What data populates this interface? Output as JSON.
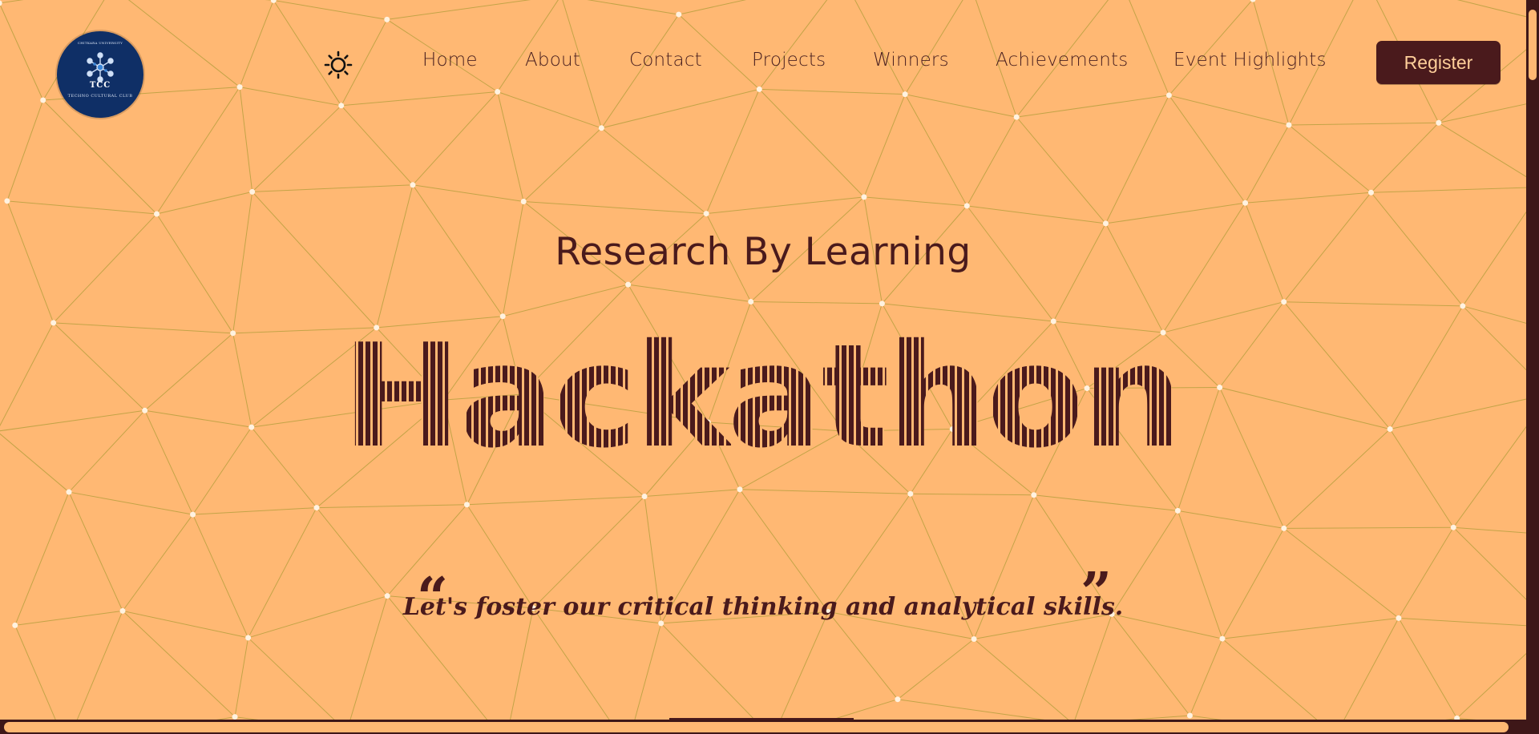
{
  "logo": {
    "abbr": "TCC",
    "name": "TECHNO CULTURAL CLUB",
    "top_text": "CHITKARA UNIVERSITY",
    "icon": "snowflake-network-icon"
  },
  "theme_toggle": {
    "icon": "sun-icon"
  },
  "nav": {
    "items": [
      {
        "label": "Home"
      },
      {
        "label": "About"
      },
      {
        "label": "Contact"
      },
      {
        "label": "Projects"
      },
      {
        "label": "Winners"
      },
      {
        "label": "Achievements"
      },
      {
        "label": "Event Highlights"
      }
    ]
  },
  "register": {
    "label": "Register"
  },
  "hero": {
    "subtitle": "Research By Learning",
    "title": "Hackathon",
    "quote": "Let's foster our critical thinking and analytical skills.",
    "open_quote": "“",
    "close_quote": "”"
  },
  "colors": {
    "background": "#FFB873",
    "primary": "#4A1A1C",
    "mesh_line": "#B9A040",
    "mesh_node": "#FFF2E0",
    "logo_bg": "#0F2F66"
  }
}
